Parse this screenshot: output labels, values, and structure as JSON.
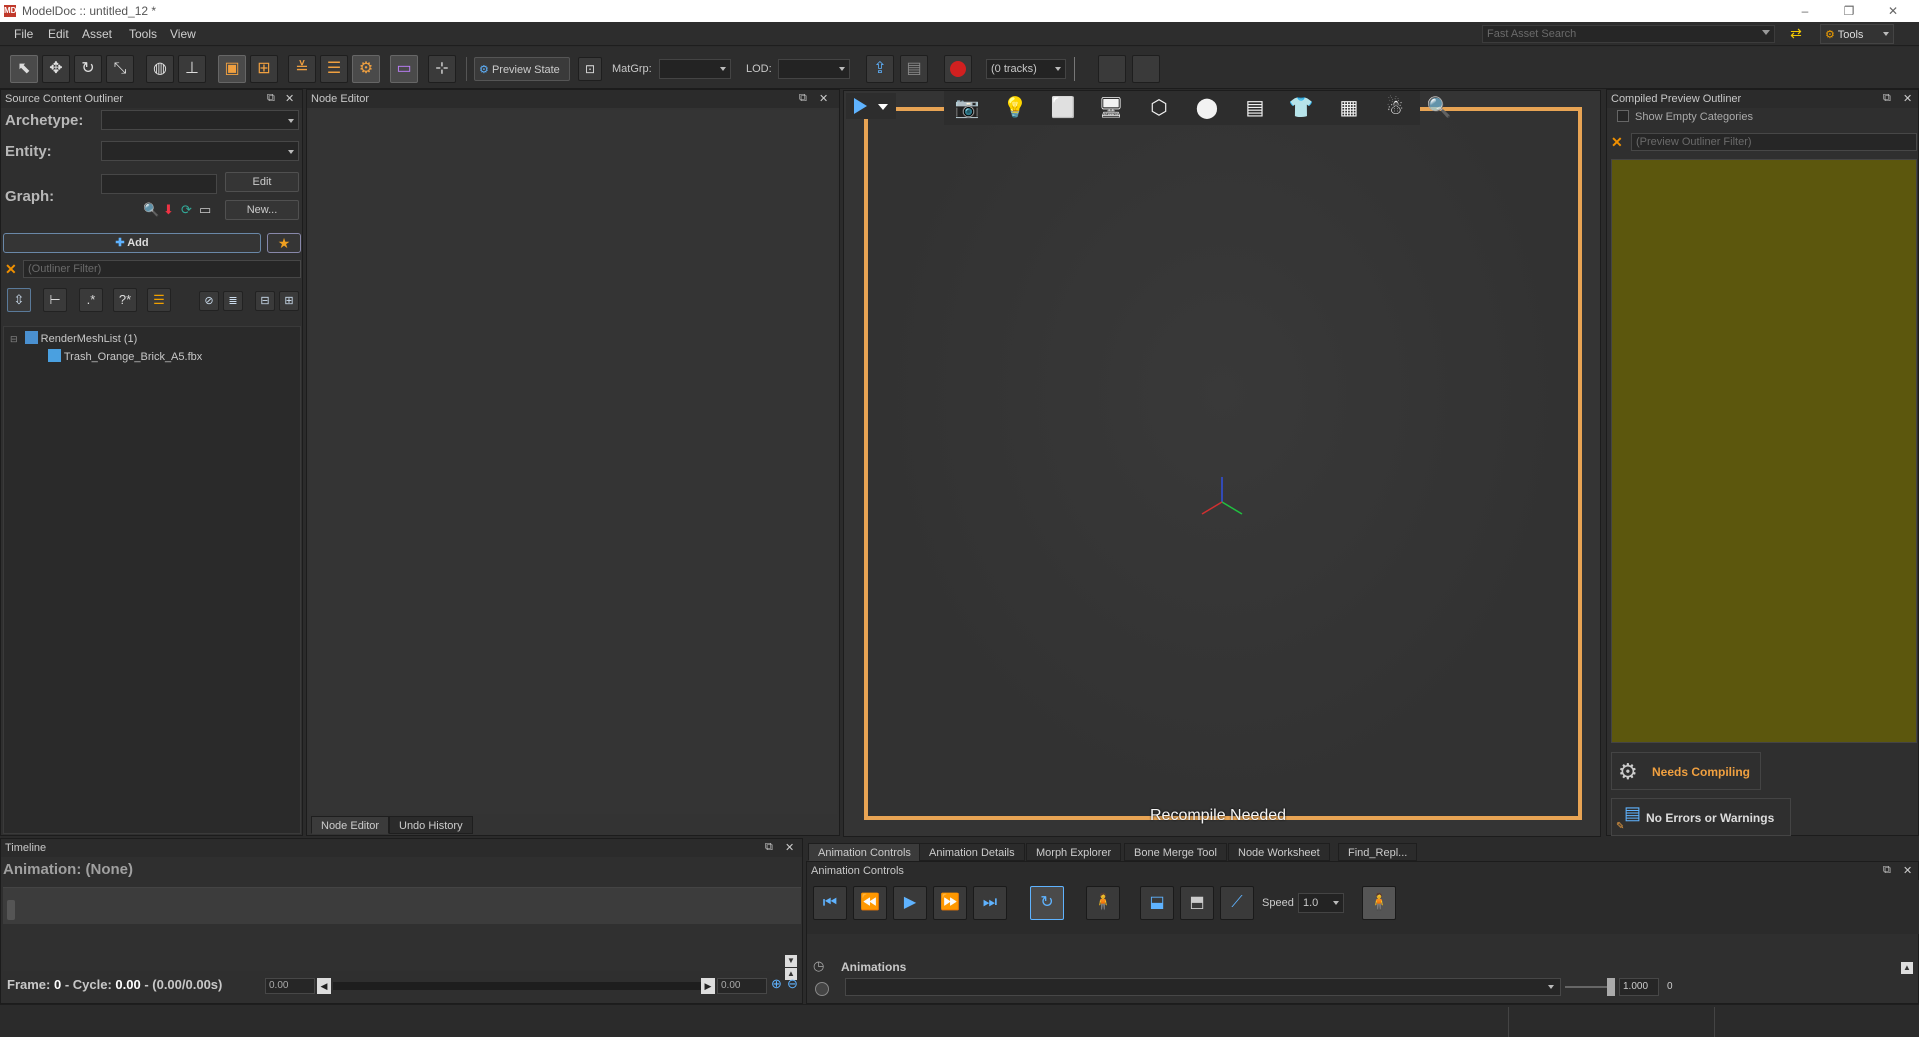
{
  "window": {
    "logo_text": "MD",
    "title": "ModelDoc :: untitled_12 *",
    "minimize": "–",
    "maximize": "❐",
    "close": "✕"
  },
  "menu": {
    "items": [
      "File",
      "Edit",
      "Asset",
      "Tools",
      "View"
    ],
    "fast_search_placeholder": "Fast Asset Search",
    "tools_label": "Tools"
  },
  "toolbar": {
    "preview_state_label": "Preview State",
    "matgrp_label": "MatGrp:",
    "matgrp_value": "",
    "lod_label": "LOD:",
    "lod_value": "",
    "tracks_value": "(0 tracks)"
  },
  "source_outliner": {
    "title": "Source Content Outliner",
    "archetype_label": "Archetype:",
    "entity_label": "Entity:",
    "graph_label": "Graph:",
    "edit_label": "Edit",
    "new_label": "New...",
    "add_label": "Add",
    "filter_placeholder": "(Outliner Filter)",
    "tree": [
      {
        "label": "RenderMeshList (1)",
        "depth": 0
      },
      {
        "label": "Trash_Orange_Brick_A5.fbx",
        "depth": 1
      }
    ]
  },
  "node_editor": {
    "title": "Node Editor",
    "tabs": [
      "Node Editor",
      "Undo History"
    ]
  },
  "viewport": {
    "recompile_text": "Recompile Needed"
  },
  "compiled_outliner": {
    "title": "Compiled Preview Outliner",
    "show_empty_label": "Show Empty Categories",
    "filter_placeholder": "(Preview Outliner Filter)",
    "needs_compiling_label": "Needs Compiling",
    "no_errors_label": "No Errors or Warnings"
  },
  "timeline": {
    "title": "Timeline",
    "animation_label": "Animation: (None)",
    "frame_text_prefix": "Frame: ",
    "frame_value": "0",
    "cycle_prefix": " - Cycle: ",
    "cycle_value": "0.00",
    "range_text": " - (0.00/0.00s)",
    "start_value": "0.00",
    "end_value": "0.00"
  },
  "bottom_tabs": [
    "Animation Controls",
    "Animation Details",
    "Morph Explorer",
    "Bone Merge Tool",
    "Node Worksheet",
    "Find_Repl..."
  ],
  "animation_controls": {
    "title": "Animation Controls",
    "speed_label": "Speed",
    "speed_value": "1.0",
    "animations_label": "Animations",
    "weight_value": "1.000",
    "weight_index": "0"
  },
  "colors": {
    "viewport_border": "#e8a454",
    "compiled_bg": "#5c570d",
    "accent_blue": "#5fb3ff"
  }
}
